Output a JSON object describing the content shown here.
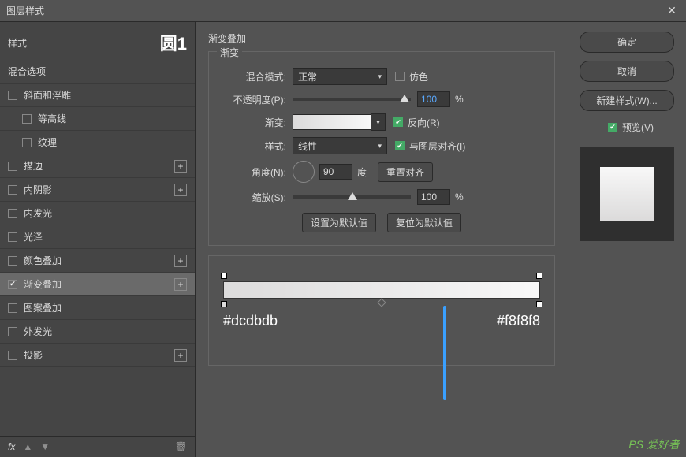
{
  "window": {
    "title": "图层样式",
    "close": "✕"
  },
  "sidebar": {
    "styles_label": "样式",
    "layer_badge": "圆1",
    "blend_options": "混合选项",
    "items": [
      {
        "label": "斜面和浮雕",
        "checked": false,
        "plus": false
      },
      {
        "label": "等高线",
        "checked": false,
        "plus": false,
        "indent": true
      },
      {
        "label": "纹理",
        "checked": false,
        "plus": false,
        "indent": true
      },
      {
        "label": "描边",
        "checked": false,
        "plus": true
      },
      {
        "label": "内阴影",
        "checked": false,
        "plus": true
      },
      {
        "label": "内发光",
        "checked": false,
        "plus": false
      },
      {
        "label": "光泽",
        "checked": false,
        "plus": false
      },
      {
        "label": "颜色叠加",
        "checked": false,
        "plus": true
      },
      {
        "label": "渐变叠加",
        "checked": true,
        "plus": true,
        "selected": true
      },
      {
        "label": "图案叠加",
        "checked": false,
        "plus": false
      },
      {
        "label": "外发光",
        "checked": false,
        "plus": false
      },
      {
        "label": "投影",
        "checked": false,
        "plus": true
      }
    ],
    "footer": {
      "fx": "fx",
      "up": "▲",
      "down": "▼",
      "trash": "🗑"
    }
  },
  "main": {
    "section_title": "渐变叠加",
    "fieldset_title": "渐变",
    "blend_mode": {
      "label": "混合模式:",
      "value": "正常"
    },
    "dither": {
      "label": "仿色",
      "checked": false
    },
    "opacity": {
      "label": "不透明度(P):",
      "value": "100",
      "unit": "%"
    },
    "gradient": {
      "label": "渐变:"
    },
    "reverse": {
      "label": "反向(R)",
      "checked": true
    },
    "style": {
      "label": "样式:",
      "value": "线性"
    },
    "align": {
      "label": "与图层对齐(I)",
      "checked": true
    },
    "angle": {
      "label": "角度(N):",
      "value": "90",
      "unit": "度"
    },
    "reset_align": "重置对齐",
    "scale": {
      "label": "缩放(S):",
      "value": "100",
      "unit": "%"
    },
    "set_default": "设置为默认值",
    "reset_default": "复位为默认值",
    "hex_left": "#dcdbdb",
    "hex_right": "#f8f8f8"
  },
  "right": {
    "ok": "确定",
    "cancel": "取消",
    "new_style": "新建样式(W)...",
    "preview": "预览(V)"
  },
  "watermark": "PS 爱好者"
}
